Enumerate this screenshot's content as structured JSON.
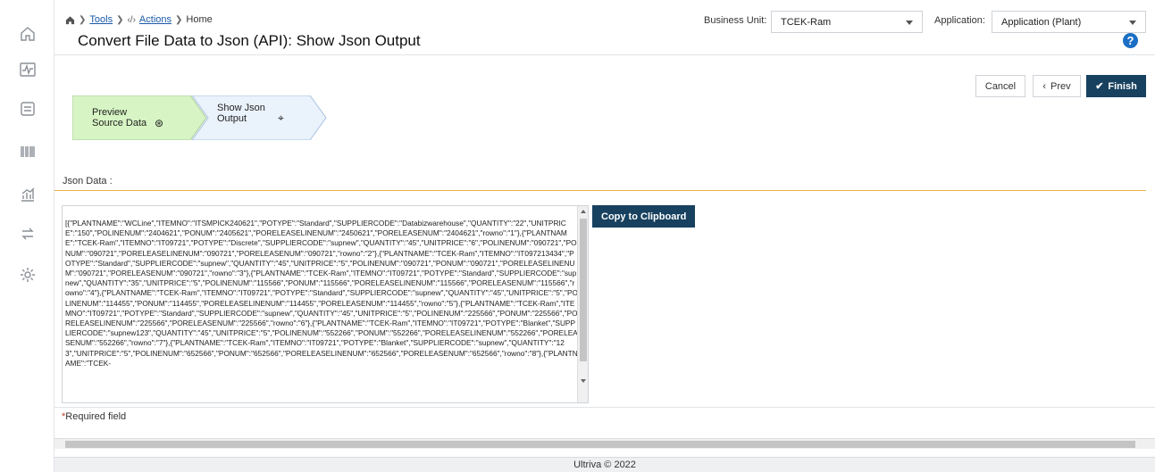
{
  "rail": {
    "items": [
      "home-icon",
      "activity-icon",
      "checklist-icon",
      "barcode-icon",
      "analytics-icon",
      "transfer-icon",
      "settings-icon"
    ]
  },
  "breadcrumb": {
    "tools": "Tools",
    "actions": "Actions",
    "current": "Home"
  },
  "header": {
    "title": "Convert File Data to Json (API): Show Json Output",
    "business_unit_label": "Business Unit:",
    "business_unit_value": "TCEK-Ram",
    "application_label": "Application:",
    "application_value": "Application (Plant)",
    "help_label": "?"
  },
  "wizard": {
    "step1_line1": "Preview",
    "step1_line2": "Source Data",
    "step1_icon": "check-circle-icon",
    "step2_line1": "Show Json",
    "step2_line2": "Output",
    "step2_icon": "pin-icon",
    "step1_color": "#d7f5c4",
    "step2_color": "#eaf2fc"
  },
  "buttons": {
    "cancel": "Cancel",
    "prev": "Prev",
    "finish": "Finish",
    "copy": "Copy to Clipboard"
  },
  "json_section": {
    "label": "Json Data :",
    "content": "[{\"PLANTNAME\":\"WCLine\",\"ITEMNO\":\"ITSMPICK240621\",\"POTYPE\":\"Standard\",\"SUPPLIERCODE\":\"Databizwarehouse\",\"QUANTITY\":\"22\",\"UNITPRICE\":\"150\",\"POLINENUM\":\"2404621\",\"PONUM\":\"2405621\",\"PORELEASELINENUM\":\"2450621\",\"PORELEASENUM\":\"2404621\",\"rowno\":\"1\"},{\"PLANTNAME\":\"TCEK-Ram\",\"ITEMNO\":\"IT09721\",\"POTYPE\":\"Discrete\",\"SUPPLIERCODE\":\"supnew\",\"QUANTITY\":\"45\",\"UNITPRICE\":\"6\",\"POLINENUM\":\"090721\",\"PONUM\":\"090721\",\"PORELEASELINENUM\":\"090721\",\"PORELEASENUM\":\"090721\",\"rowno\":\"2\"},{\"PLANTNAME\":\"TCEK-Ram\",\"ITEMNO\":\"IT097213434\",\"POTYPE\":\"Standard\",\"SUPPLIERCODE\":\"supnew\",\"QUANTITY\":\"45\",\"UNITPRICE\":\"5\",\"POLINENUM\":\"090721\",\"PONUM\":\"090721\",\"PORELEASELINENUM\":\"090721\",\"PORELEASENUM\":\"090721\",\"rowno\":\"3\"},{\"PLANTNAME\":\"TCEK-Ram\",\"ITEMNO\":\"IT09721\",\"POTYPE\":\"Standard\",\"SUPPLIERCODE\":\"supnew\",\"QUANTITY\":\"35\",\"UNITPRICE\":\"5\",\"POLINENUM\":\"115566\",\"PONUM\":\"115566\",\"PORELEASELINENUM\":\"115566\",\"PORELEASENUM\":\"115566\",\"rowno\":\"4\"},{\"PLANTNAME\":\"TCEK-Ram\",\"ITEMNO\":\"IT09721\",\"POTYPE\":\"Standard\",\"SUPPLIERCODE\":\"supnew\",\"QUANTITY\":\"45\",\"UNITPRICE\":\"5\",\"POLINENUM\":\"114455\",\"PONUM\":\"114455\",\"PORELEASELINENUM\":\"114455\",\"PORELEASENUM\":\"114455\",\"rowno\":\"5\"},{\"PLANTNAME\":\"TCEK-Ram\",\"ITEMNO\":\"IT09721\",\"POTYPE\":\"Standard\",\"SUPPLIERCODE\":\"supnew\",\"QUANTITY\":\"45\",\"UNITPRICE\":\"5\",\"POLINENUM\":\"225566\",\"PONUM\":\"225566\",\"PORELEASELINENUM\":\"225566\",\"PORELEASENUM\":\"225566\",\"rowno\":\"6\"},{\"PLANTNAME\":\"TCEK-Ram\",\"ITEMNO\":\"IT09721\",\"POTYPE\":\"Blanket\",\"SUPPLIERCODE\":\"supnew123\",\"QUANTITY\":\"45\",\"UNITPRICE\":\"5\",\"POLINENUM\":\"552266\",\"PONUM\":\"552266\",\"PORELEASELINENUM\":\"552266\",\"PORELEASENUM\":\"552266\",\"rowno\":\"7\"},{\"PLANTNAME\":\"TCEK-Ram\",\"ITEMNO\":\"IT09721\",\"POTYPE\":\"Blanket\",\"SUPPLIERCODE\":\"supnew\",\"QUANTITY\":\"123\",\"UNITPRICE\":\"5\",\"POLINENUM\":\"652566\",\"PONUM\":\"652566\",\"PORELEASELINENUM\":\"652566\",\"PORELEASENUM\":\"652566\",\"rowno\":\"8\"},{\"PLANTNAME\":\"TCEK-"
  },
  "required": {
    "star": "*",
    "text": "Required field"
  },
  "footer": {
    "text": "Ultriva © 2022"
  },
  "colors": {
    "primary": "#17415f",
    "accent_rule": "#e8b24a",
    "link": "#1a5aa8",
    "help": "#1a6fc4"
  }
}
